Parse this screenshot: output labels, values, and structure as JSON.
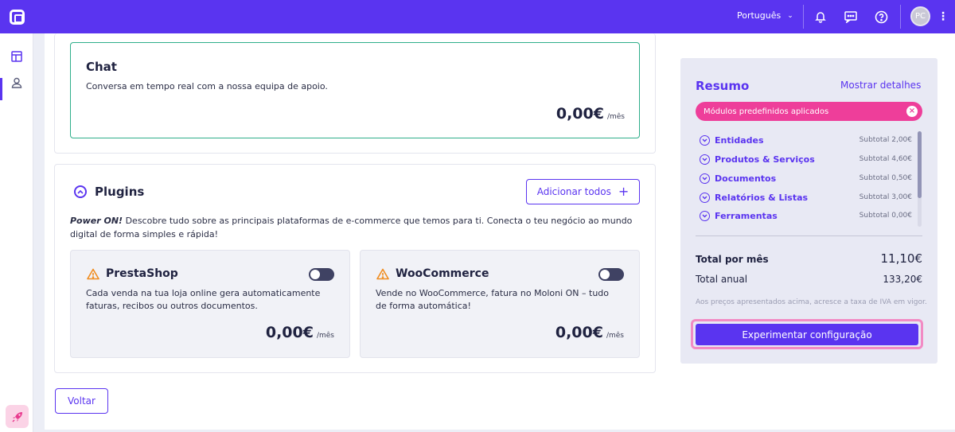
{
  "topbar": {
    "language": "Português",
    "avatar_initials": "PC",
    "kebab": "⋮"
  },
  "chat": {
    "title": "Chat",
    "description": "Conversa em tempo real com a nossa equipa de apoio.",
    "price": "0,00€",
    "price_unit": "/mês"
  },
  "plugins": {
    "title": "Plugins",
    "add_all_label": "Adicionar todos",
    "description_bold": "Power ON!",
    "description_rest": " Descobre tudo sobre as principais plataformas de e-commerce que temos para ti. Conecta o teu negócio ao mundo digital de forma simples e rápida!",
    "items": [
      {
        "name": "PrestaShop",
        "description": "Cada venda na tua loja online gera automaticamente faturas, recibos ou outros documentos.",
        "price": "0,00€",
        "price_unit": "/mês",
        "enabled": false
      },
      {
        "name": "WooCommerce",
        "description": "Vende no WooCommerce, fatura no Moloni ON – tudo de forma automática!",
        "price": "0,00€",
        "price_unit": "/mês",
        "enabled": false
      }
    ]
  },
  "back_label": "Voltar",
  "summary": {
    "title": "Resumo",
    "details_link": "Mostrar detalhes",
    "pill_label": "Módulos predefinidos aplicados",
    "modules": [
      {
        "name": "Entidades",
        "subtotal": "Subtotal 2,00€"
      },
      {
        "name": "Produtos & Serviços",
        "subtotal": "Subtotal 4,60€"
      },
      {
        "name": "Documentos",
        "subtotal": "Subtotal 0,50€"
      },
      {
        "name": "Relatórios & Listas",
        "subtotal": "Subtotal 3,00€"
      },
      {
        "name": "Ferramentas",
        "subtotal": "Subtotal 0,00€"
      }
    ],
    "monthly_label": "Total por mês",
    "monthly_value": "11,10€",
    "annual_label": "Total anual",
    "annual_value": "133,20€",
    "vat_note": "Aos preços apresentados acima, acresce a taxa de IVA em vigor.",
    "cta_label": "Experimentar configuração"
  },
  "colors": {
    "brand": "#5a34f0",
    "accent_pink": "#ee3e9a",
    "chat_border": "#2fae8a",
    "warning": "#f08c1e"
  }
}
